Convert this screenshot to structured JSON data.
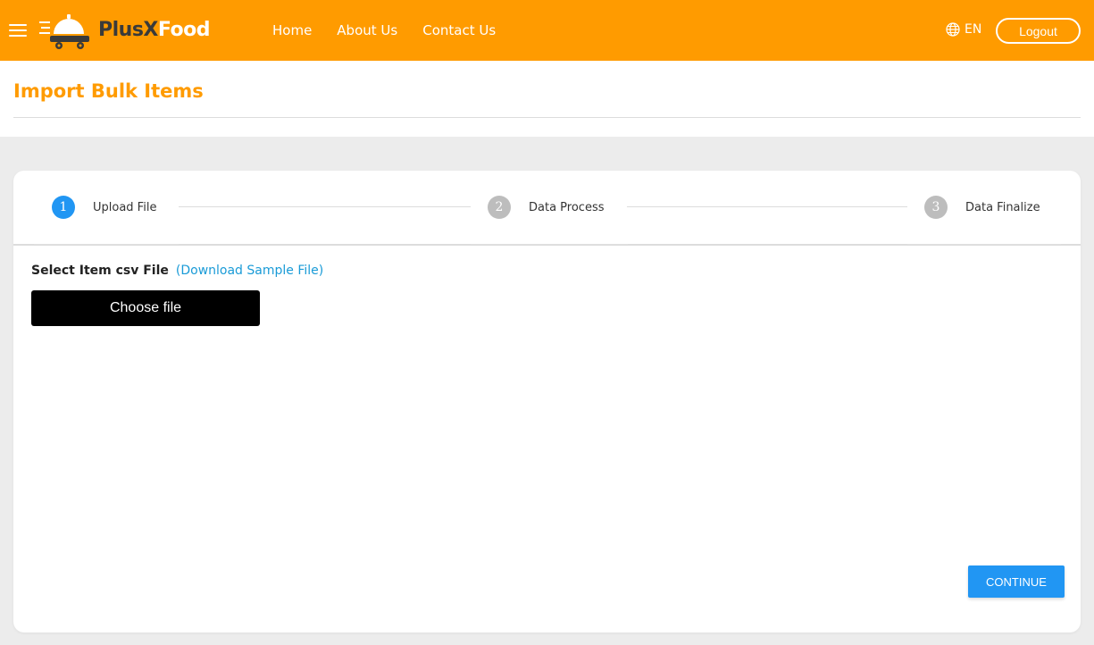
{
  "header": {
    "brand_part1": "Plus",
    "brand_part2": "X",
    "brand_part3": "Food",
    "nav": [
      "Home",
      "About Us",
      "Contact Us"
    ],
    "language": "EN",
    "logout_label": "Logout",
    "accent_color": "#ff9b00"
  },
  "page": {
    "title": "Import Bulk Items"
  },
  "stepper": {
    "steps": [
      {
        "number": "1",
        "label": "Upload File",
        "state": "active"
      },
      {
        "number": "2",
        "label": "Data Process",
        "state": "inactive"
      },
      {
        "number": "3",
        "label": "Data Finalize",
        "state": "inactive"
      }
    ]
  },
  "upload": {
    "label": "Select Item csv File",
    "download_link": "(Download Sample File)",
    "choose_label": "Choose file"
  },
  "actions": {
    "continue_label": "CONTINUE",
    "continue_color": "#2196f3"
  },
  "icons": {
    "menu": "hamburger-icon",
    "logo": "food-delivery-logo-icon",
    "language": "globe-icon"
  }
}
